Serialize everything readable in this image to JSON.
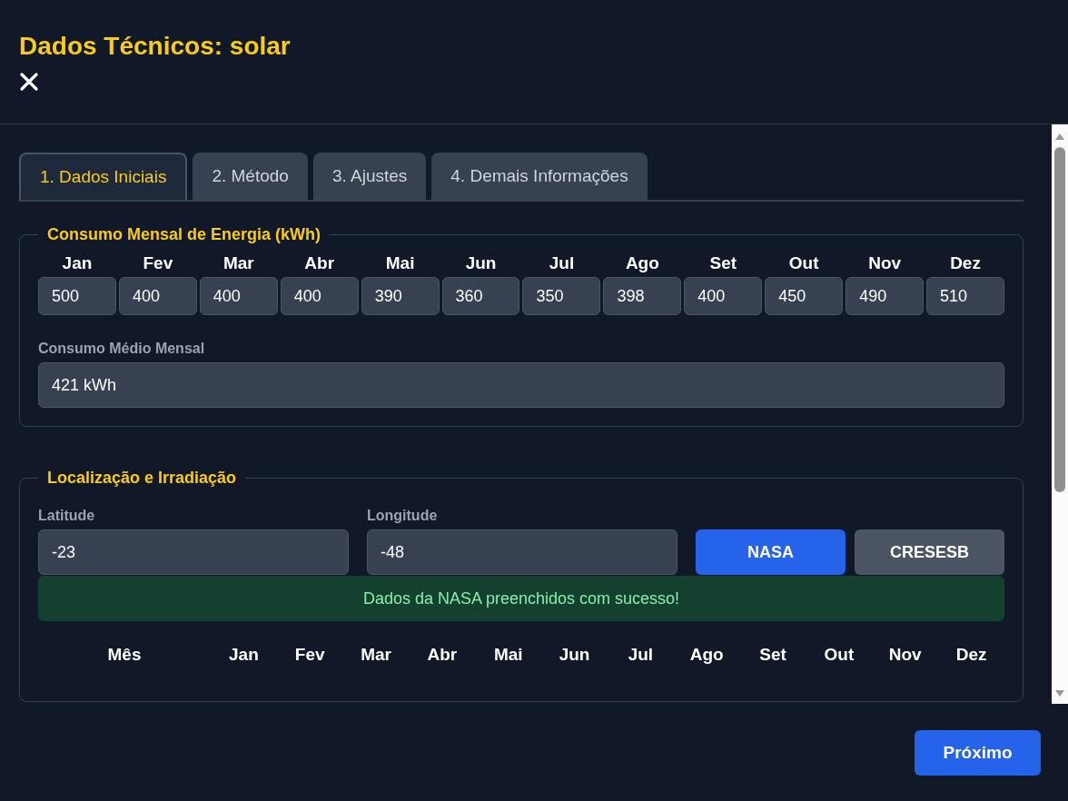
{
  "dialog": {
    "title": "Dados Técnicos: solar"
  },
  "tabs": [
    {
      "label": "1. Dados Iniciais",
      "selected": true
    },
    {
      "label": "2. Método",
      "selected": false
    },
    {
      "label": "3. Ajustes",
      "selected": false
    },
    {
      "label": "4. Demais Informações",
      "selected": false
    }
  ],
  "consumption": {
    "legend": "Consumo Mensal de Energia (kWh)",
    "months": [
      {
        "label": "Jan",
        "value": "500"
      },
      {
        "label": "Fev",
        "value": "400"
      },
      {
        "label": "Mar",
        "value": "400"
      },
      {
        "label": "Abr",
        "value": "400"
      },
      {
        "label": "Mai",
        "value": "390"
      },
      {
        "label": "Jun",
        "value": "360"
      },
      {
        "label": "Jul",
        "value": "350"
      },
      {
        "label": "Ago",
        "value": "398"
      },
      {
        "label": "Set",
        "value": "400"
      },
      {
        "label": "Out",
        "value": "450"
      },
      {
        "label": "Nov",
        "value": "490"
      },
      {
        "label": "Dez",
        "value": "510"
      }
    ],
    "average": {
      "label": "Consumo Médio Mensal",
      "value": "421 kWh"
    }
  },
  "location": {
    "legend": "Localização e Irradiação",
    "latitude": {
      "label": "Latitude",
      "value": "-23"
    },
    "longitude": {
      "label": "Longitude",
      "value": "-48"
    },
    "buttons": [
      {
        "label": "NASA",
        "kind": "primary"
      },
      {
        "label": "CRESESB",
        "kind": "secondary"
      }
    ],
    "message": "Dados da NASA preenchidos com sucesso!",
    "table": {
      "columns": [
        "Mês",
        "Jan",
        "Fev",
        "Mar",
        "Abr",
        "Mai",
        "Jun",
        "Jul",
        "Ago",
        "Set",
        "Out",
        "Nov",
        "Dez"
      ]
    }
  },
  "footer": {
    "next_button": "Próximo"
  }
}
